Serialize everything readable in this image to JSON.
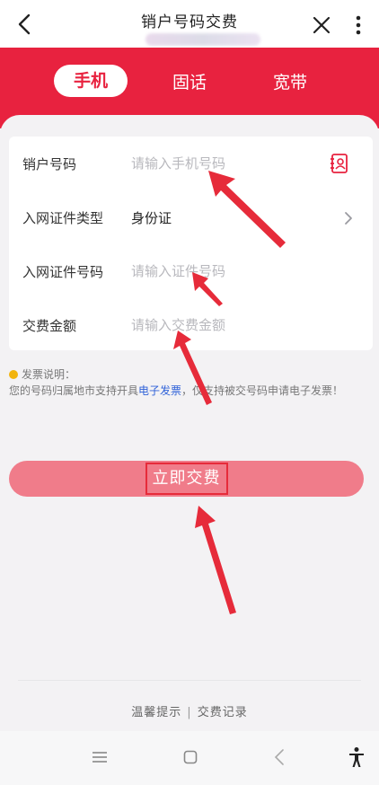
{
  "header": {
    "title": "销户号码交费",
    "back_icon": "chevron-left-icon",
    "close_icon": "close-icon",
    "more_icon": "more-vertical-icon"
  },
  "tabs": [
    {
      "label": "手机",
      "active": true
    },
    {
      "label": "固话",
      "active": false
    },
    {
      "label": "宽带",
      "active": false
    }
  ],
  "form": {
    "phone": {
      "label": "销户号码",
      "placeholder": "请输入手机号码",
      "icon": "contact-book-icon"
    },
    "id_type": {
      "label": "入网证件类型",
      "value": "身份证",
      "icon": "chevron-right-icon"
    },
    "id_number": {
      "label": "入网证件号码",
      "placeholder": "请输入证件号码"
    },
    "amount": {
      "label": "交费金额",
      "placeholder": "请输入交费金额"
    }
  },
  "notice": {
    "title": "发票说明：",
    "text_before": "您的号码归属地市支持开具",
    "link": "电子发票",
    "text_after": "，仅支持被交号码申请电子发票！"
  },
  "pay_button": {
    "label": "立即交费"
  },
  "footer": {
    "tips": "温馨提示",
    "separator": "|",
    "records": "交费记录"
  },
  "colors": {
    "brand_red": "#e8223f",
    "button_pink": "#f07c8a",
    "link_blue": "#2f62d8",
    "annotation_red": "#e62b3a"
  }
}
